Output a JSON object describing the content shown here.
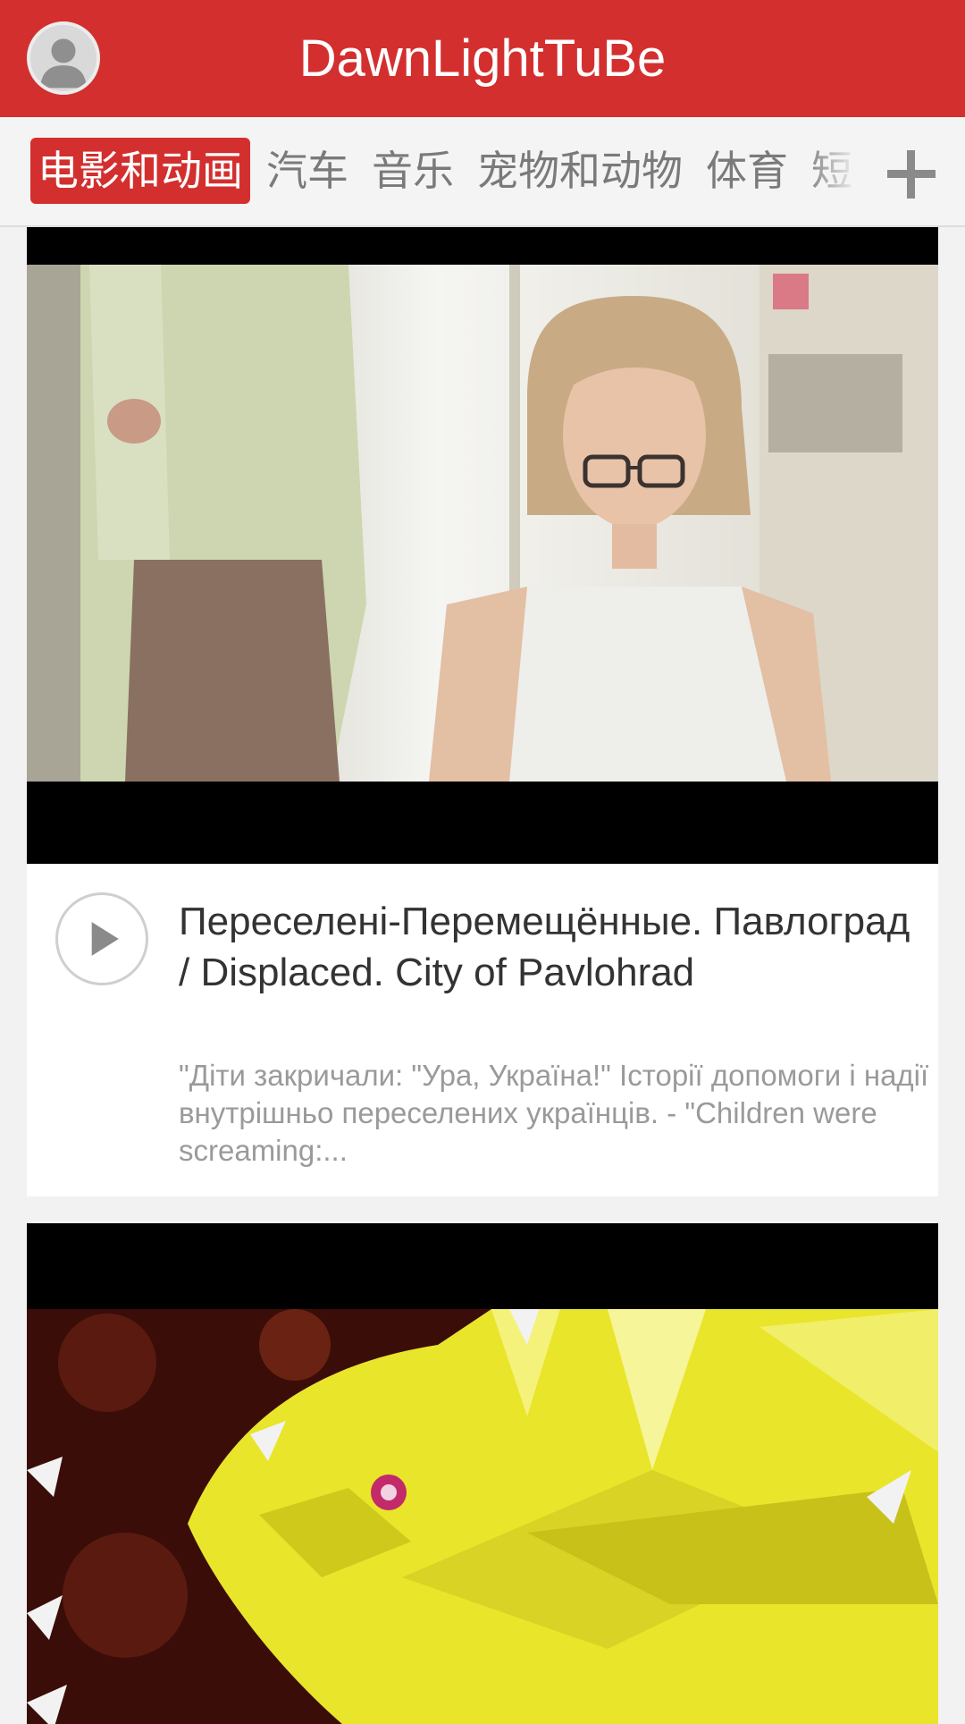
{
  "app": {
    "title": "DawnLightTuBe"
  },
  "colors": {
    "brand": "#d32f2f"
  },
  "icons": {
    "avatar": "user-silhouette-icon",
    "add": "plus-icon",
    "play": "play-icon"
  },
  "tabs": [
    {
      "label": "电影和动画",
      "active": true
    },
    {
      "label": "汽车",
      "active": false
    },
    {
      "label": "音乐",
      "active": false
    },
    {
      "label": "宠物和动物",
      "active": false
    },
    {
      "label": "体育",
      "active": false
    },
    {
      "label": "短",
      "active": false
    }
  ],
  "videos": [
    {
      "title": "Переселені-Перемещённые. Павлоград / Displaced. City of Pavlohrad",
      "description": "\"Діти закричали: \"Ура, Україна!\" Історії допомоги і надії внутрішньо переселених українців. - \"Children were screaming:..."
    }
  ]
}
